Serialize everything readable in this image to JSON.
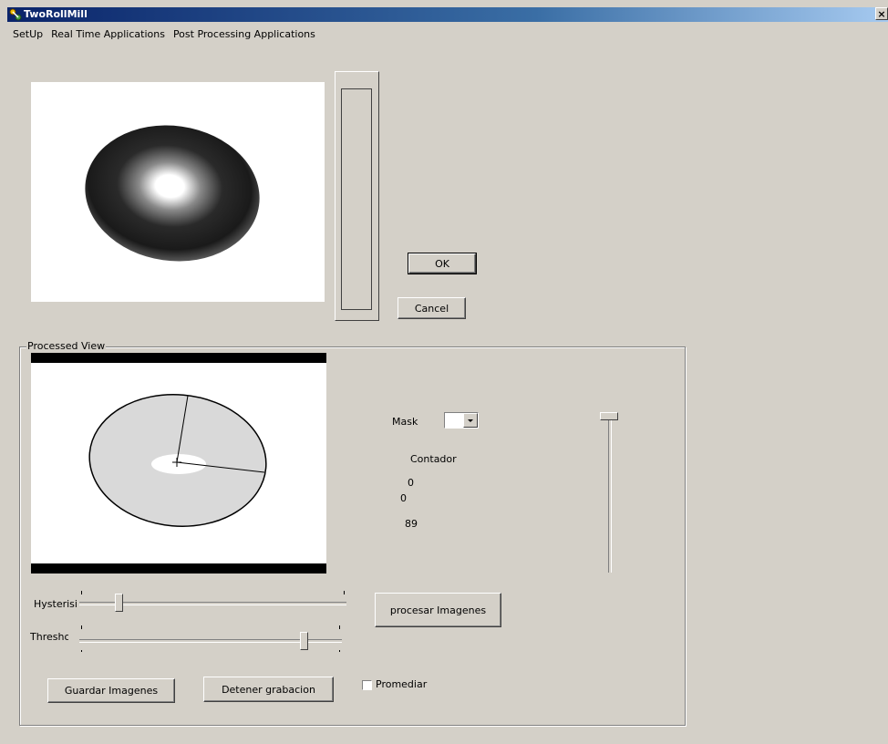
{
  "window": {
    "title": "TwoRollMill",
    "close_label": "×"
  },
  "menu": [
    "SetUp",
    "Real Time Applications",
    "Post Processing Applications"
  ],
  "buttons": {
    "ok": "OK",
    "cancel": "Cancel",
    "procesar": "procesar Imagenes",
    "guardar": "Guardar Imagenes",
    "detener": "Detener grabacion"
  },
  "processed": {
    "group_title": "Processed View",
    "mask_label": "Mask",
    "contador_label": "Contador",
    "value1": "0",
    "value2": "0",
    "value3": "89"
  },
  "sliders": {
    "hysteresis_label": "Hysterisi",
    "hysteresis_level": 0.15,
    "threshold_label": "Threshold",
    "threshold_level": 0.86,
    "vertical_level": 0.0
  },
  "checkbox": {
    "label": "Promediar",
    "checked": false
  },
  "icons": {
    "app": "app-icon",
    "dropdown": "dropdown-arrow-icon"
  }
}
